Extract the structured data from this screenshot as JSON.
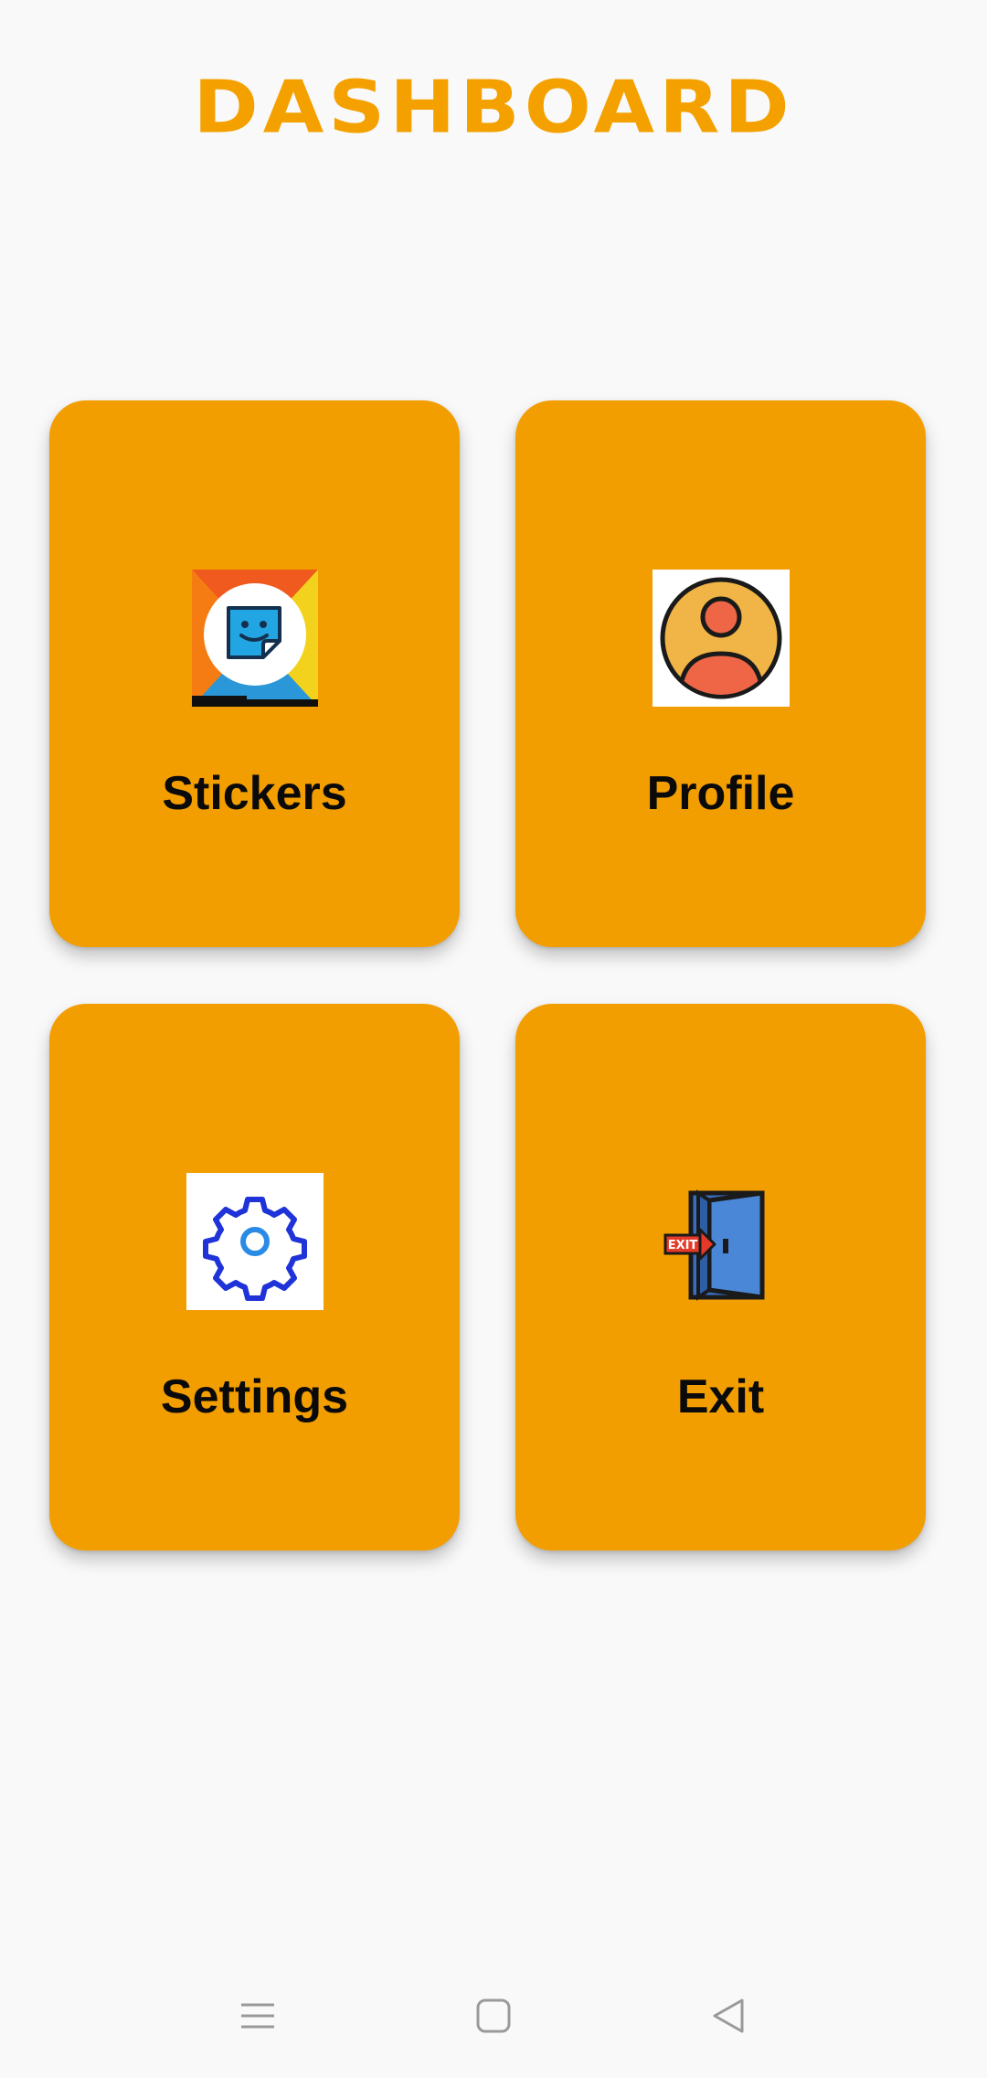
{
  "header": {
    "title": "DASHBOARD"
  },
  "cards": [
    {
      "label": "Stickers",
      "icon": "sticker-app-icon"
    },
    {
      "label": "Profile",
      "icon": "user-profile-icon"
    },
    {
      "label": "Settings",
      "icon": "gear-icon"
    },
    {
      "label": "Exit",
      "icon": "exit-door-icon",
      "icon_text": "EXIT"
    }
  ],
  "navbar": {
    "icons": [
      "menu-icon",
      "home-square-icon",
      "back-triangle-icon"
    ]
  },
  "colors": {
    "accent": "#f4a100",
    "card": "#f39e00",
    "background": "#f9f9f9"
  }
}
